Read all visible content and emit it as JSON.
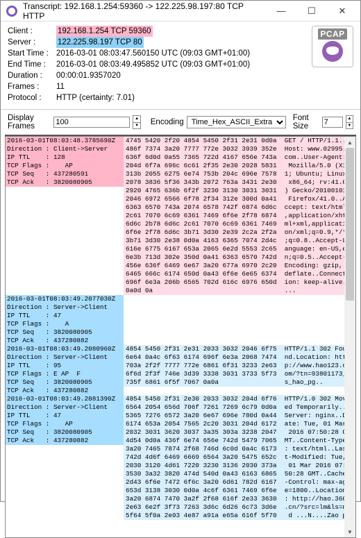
{
  "title": "Transcript: 192.168.1.254:59360 -> 122.225.98.197:80 TCP HTTP",
  "info": {
    "client_lbl": "Client :",
    "client": "192.168.1.254 TCP 59360",
    "server_lbl": "Server :",
    "server": "122.225.98.197 TCP 80",
    "start_lbl": "Start Time :",
    "start": "2016-03-01 08:03:47.560150 UTC   (09:03 GMT+01:00)",
    "end_lbl": "End Time :",
    "end": "2016-03-01 08:03:49.495852 UTC   (09:03 GMT+01:00)",
    "dur_lbl": "Duration :",
    "dur": "00:00:01.9357020",
    "frames_lbl": "Frames :",
    "frames": "11",
    "proto_lbl": "Protocol :",
    "proto": "HTTP (certainty: 7.01)"
  },
  "pcap": "PCAP",
  "ctrl": {
    "df": "Display Frames",
    "df_val": "100",
    "enc": "Encoding",
    "enc_val": "Time_Hex_ASCII_Extra",
    "fs": "Font Size",
    "fs_val": "7"
  },
  "blocks": [
    {
      "metac": "clr-pink",
      "hexc": "clr-ltp",
      "meta": "2016-03-01T08:03:48.3785690Z\nDirection : Client->Server\nIP TTL    : 128\nTCP Flags :    AP\nTCP Seq   : 437280591\nTCP Ack   : 3820080905",
      "hex": "4745 5420 2f20 4854 5450 2f31 2e31 0d0a  GET / HTTP/1.1..\n486f 7374 3a20 7777 772e 3032 3939 352e  Host: www.02995.\n636f 6d0d 0a55 7365 722d 4167 656e 743a  com..User-Agent:\n204d 6f7a 696c 6c61 2f35 2e30 2028 5831   Mozilla/5.0 (X1\n313b 2055 6275 6e74 753b 204c 696e 7578  1; Ubuntu; Linux\n2078 3836 5f36 343b 2072 763a 3431 2e30   x86_64; rv:41.0\n2920 4765 636b 6f2f 3230 3130 3031 3031  ) Gecko/20100101\n2046 6972 6566 6f78 2f34 312e 300d 0a41   Firefox/41.0..A\n6363 6570 743a 2074 6578 742f 6874 6d6c  ccept: text/html\n2c61 7070 6c69 6361 7469 6f6e 2f78 6874  ,application/xht\n6d6c 2b78 6d6c 2c61 7070 6c69 6361 7469  ml+xml,applicati\n6f6e 2f78 6d6c 3b71 3d30 2e39 2c2a 2f2a  on/xml;q=0.9,*/*\n3b71 3d30 2e38 0d0a 4163 6365 7074 2d4c  ;q=0.8..Accept-L\n616e 6775 6167 653a 2065 6e2d 5553 2c65  anguage: en-US,e\n6e3b 713d 302e 350d 0a41 6363 6570 742d  n;q=0.5..Accept-\n456e 636f 6469 6e67 3a20 677a 6970 2c20  Encoding: gzip, \n6465 666c 6174 650d 0a43 6f6e 6e65 6374  deflate..Connect\n696f 6e3a 206b 6565 702d 616c 6976 650d  ion: keep-alive.\n0a0d 0a                                  ..."
    },
    {
      "metac": "clr-blue",
      "hexc": "",
      "meta": "2016-03-01T08:03:49.2077030Z\nDirection : Server->Client\nIP TTL    : 47\nTCP Flags :    A\nTCP Seq   : 3820080905\nTCP Ack   : 437280882",
      "hex": ""
    },
    {
      "metac": "clr-blue",
      "hexc": "clr-pale",
      "meta": "2016-03-01T08:03:49.2080960Z\nDirection : Server->Client\nIP TTL    : 95\nTCP Flags : E AP  F\nTCP Seq   : 3820080905\nTCP Ack   : 437280882",
      "hex": "4854 5450 2f31 2e31 2033 3032 2046 6f75  HTTP/1.1 302 Fou\n6e64 0a4c 6f63 6174 696f 6e3a 2068 7474  nd.Location: htt\n703a 2f2f 7777 772e 6861 6f31 3233 2e63  p://www.hao123.c\n6f6d 2f3f 746e 3d39 3338 3031 3733 5f73  om/?tn=93801173_\n735f 6861 6f5f 7067 0a0a                 s_hao_pg..      "
    },
    {
      "metac": "clr-blue",
      "hexc": "clr-pale",
      "meta": "2016-03-01T08:03:49.2081390Z\nDirection : Server->Client\nIP TTL    : 47\nTCP Flags :    AP\nTCP Seq   : 3820080905\nTCP Ack   : 437280882",
      "hex": "4854 5450 2f31 2e30 2033 3032 204d 6f76  HTTP/1.0 302 Mov\n6564 2054 656d 706f 7261 7269 6c79 0d0a  ed Temporarily..\n5365 7276 6572 3a20 6e67 696e 780d 0a44  Server: nginx..D\n6174 653a 2054 7565 2c20 3031 204d 6172  ate: Tue, 01 Mar\n2032 3031 3620 3037 3a35 303a 3238 2047   2016 07:50:28 G\n4d54 0d0a 436f 6e74 656e 742d 5479 7065  MT..Content-Type\n3a20 7465 7874 2f68 746d 6c0d 0a4c 6173  : text/html..Las\n742d 4d6f 6469 6669 6564 3a20 5475 652c  t-Modified: Tue,\n2030 3120 4d61 7220 3230 3136 2030 373a   01 Mar 2016 07:\n3530 3a32 3820 474d 540d 0a43 6163 6865  50:28 GMT..Cache\n2d43 6f6e 7472 6f6c 3a20 6d61 782d 6167  -Control: max-ag\n653d 3138 3030 0d0a 4c6f 6361 7469 6f6e  e=1800..Location\n3a20 6874 7470 3a2f 2f68 616f 2e33 3630  : http://hao.360\n2e63 6e2f 3f73 7263 3d6c 6d26 6c73 3d6e  .cn/?src=lm&ls=n\n5f64 5f0a 2e03 4e87 a91a e65a 616f 5f70   d ...N....Zao p"
    }
  ]
}
